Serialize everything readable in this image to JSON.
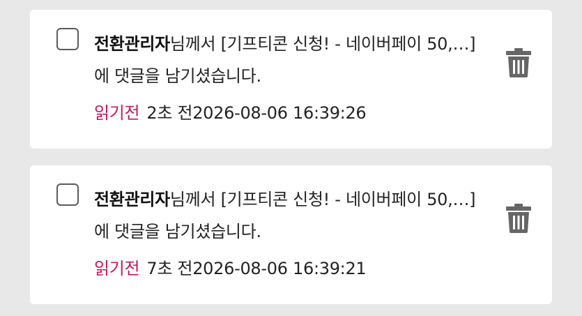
{
  "notifications": [
    {
      "author": "전환관리자",
      "message": "님께서 [기프티콘 신청! - 네이버페이 50,…] 에 댓글을 남기셨습니다.",
      "status": "읽기전",
      "relative_time": "2초 전",
      "timestamp": "2026-08-06 16:39:26",
      "icon": "trash-icon"
    },
    {
      "author": "전환관리자",
      "message": "님께서 [기프티콘 신청! - 네이버페이 50,…] 에 댓글을 남기셨습니다.",
      "status": "읽기전",
      "relative_time": "7초 전",
      "timestamp": "2026-08-06 16:39:21",
      "icon": "trash-icon"
    }
  ],
  "colors": {
    "background": "#e8e8e8",
    "card": "#ffffff",
    "unread_status": "#c2185b",
    "trash_icon": "#666666"
  }
}
